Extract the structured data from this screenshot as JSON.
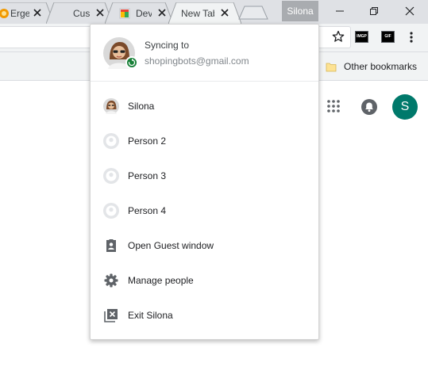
{
  "tabs": [
    {
      "title": "Erge",
      "favicon": "orange-favicon"
    },
    {
      "title": "Cus",
      "favicon": "none"
    },
    {
      "title": "Dev",
      "favicon": "chrome-dev-favicon"
    },
    {
      "title": "New Tab",
      "favicon": "none",
      "active": true
    }
  ],
  "window": {
    "profile_name": "Silona",
    "controls": [
      "minimize-icon",
      "restore-icon",
      "close-icon"
    ]
  },
  "toolbar": {
    "icons": [
      "star-icon",
      "extension-icon",
      "extension-icon",
      "menu-kebab-icon"
    ],
    "extension_labels": [
      "IMGP",
      "GIF"
    ]
  },
  "bookmarks": {
    "other_label": "Other bookmarks"
  },
  "ntp": {
    "account_initial": "S",
    "account_color": "#00796b",
    "icons": [
      "apps-grid-icon",
      "notifications-bell-icon"
    ]
  },
  "profile_menu": {
    "sync_title": "Syncing to",
    "sync_email": "shopingbots@gmail.com",
    "sync_badge_color": "#188038",
    "people": [
      {
        "name": "Silona",
        "icon": "profile-photo-icon"
      },
      {
        "name": "Person 2",
        "icon": "default-avatar-icon"
      },
      {
        "name": "Person 3",
        "icon": "default-avatar-icon"
      },
      {
        "name": "Person 4",
        "icon": "default-avatar-icon"
      }
    ],
    "actions": [
      {
        "label": "Open Guest window",
        "icon": "guest-icon"
      },
      {
        "label": "Manage people",
        "icon": "settings-gear-icon"
      },
      {
        "label": "Exit Silona",
        "icon": "exit-icon"
      }
    ]
  }
}
